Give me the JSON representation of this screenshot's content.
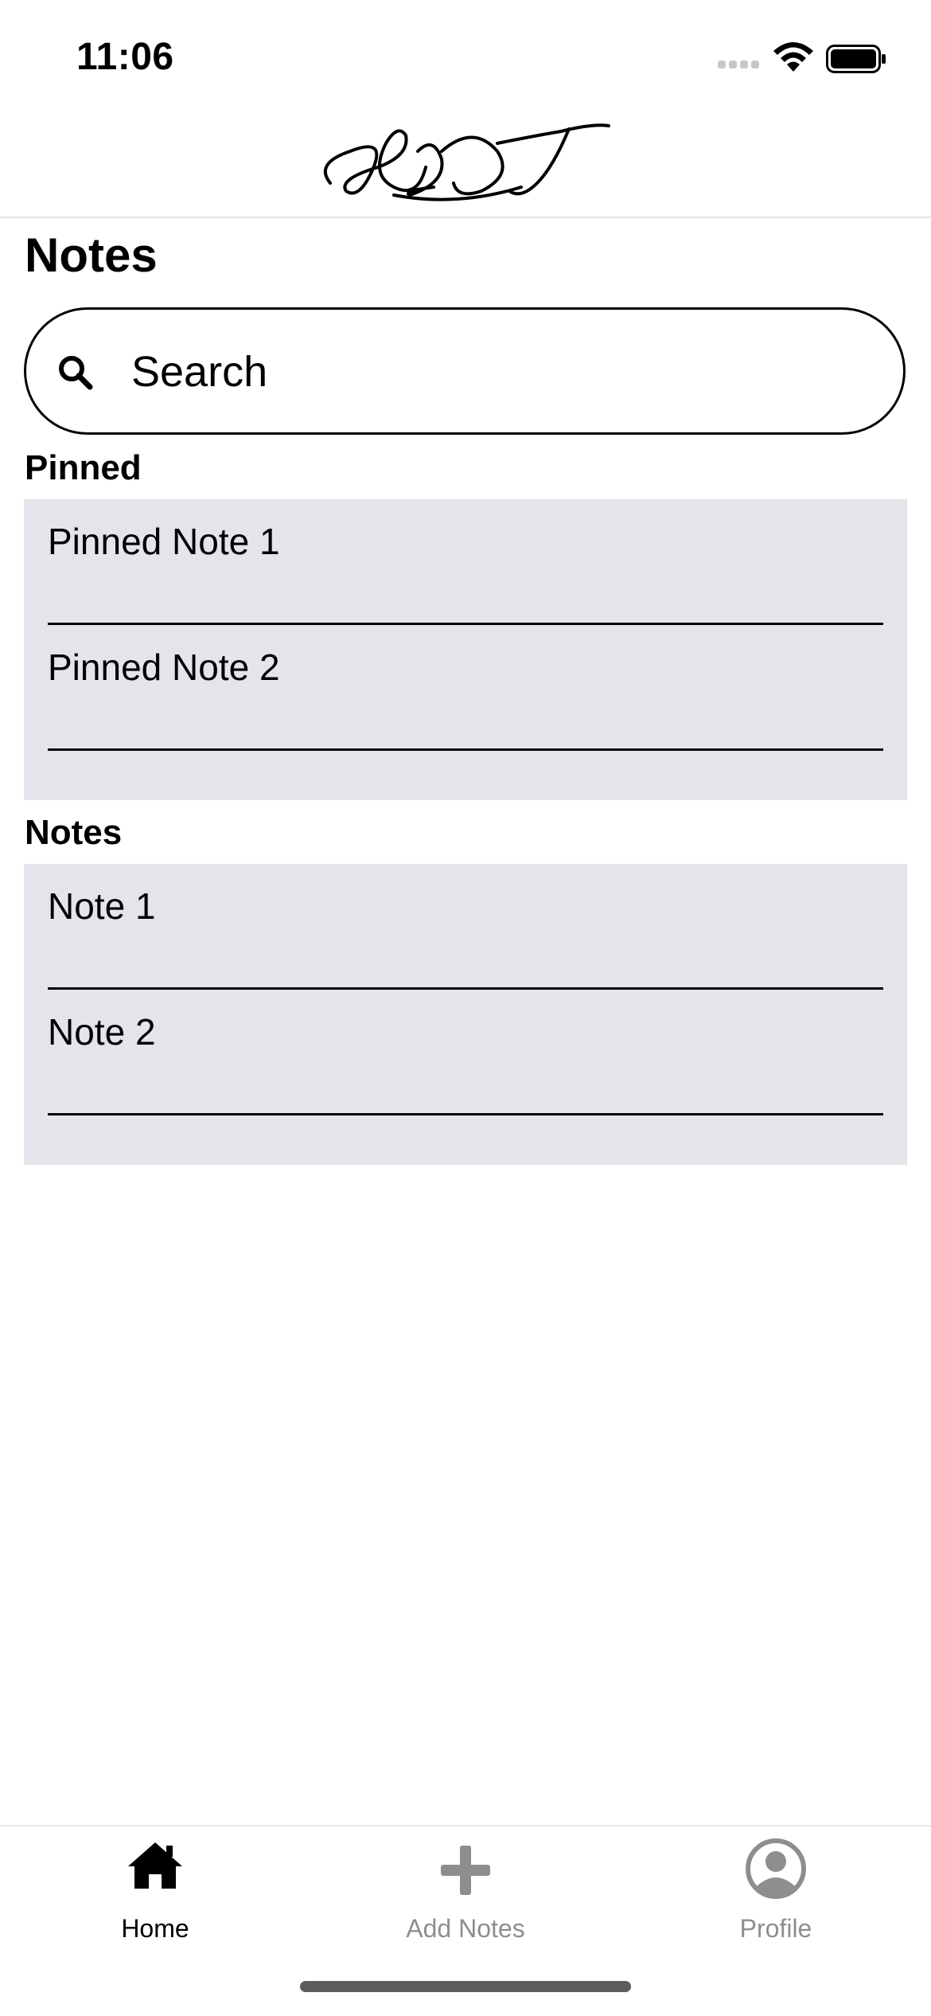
{
  "status_bar": {
    "time": "11:06",
    "signal_icon": "signal-dots-icon",
    "wifi_icon": "wifi-icon",
    "battery_icon": "battery-icon"
  },
  "header": {
    "logo_icon": "signature-logo",
    "logo_text": "LJT"
  },
  "page": {
    "title": "Notes"
  },
  "search": {
    "placeholder": "Search",
    "value": "",
    "icon": "search-icon"
  },
  "pinned": {
    "label": "Pinned",
    "items": [
      {
        "title": "Pinned Note 1"
      },
      {
        "title": "Pinned Note 2"
      }
    ]
  },
  "notes": {
    "label": "Notes",
    "items": [
      {
        "title": "Note 1"
      },
      {
        "title": "Note 2"
      }
    ]
  },
  "tabs": [
    {
      "label": "Home",
      "icon": "home-icon",
      "active": true
    },
    {
      "label": "Add Notes",
      "icon": "plus-icon",
      "active": false
    },
    {
      "label": "Profile",
      "icon": "profile-icon",
      "active": false
    }
  ],
  "colors": {
    "card_background": "#e4e5ea",
    "tab_active": "#000000",
    "tab_inactive": "#8e8e8e",
    "divider": "#000000"
  }
}
